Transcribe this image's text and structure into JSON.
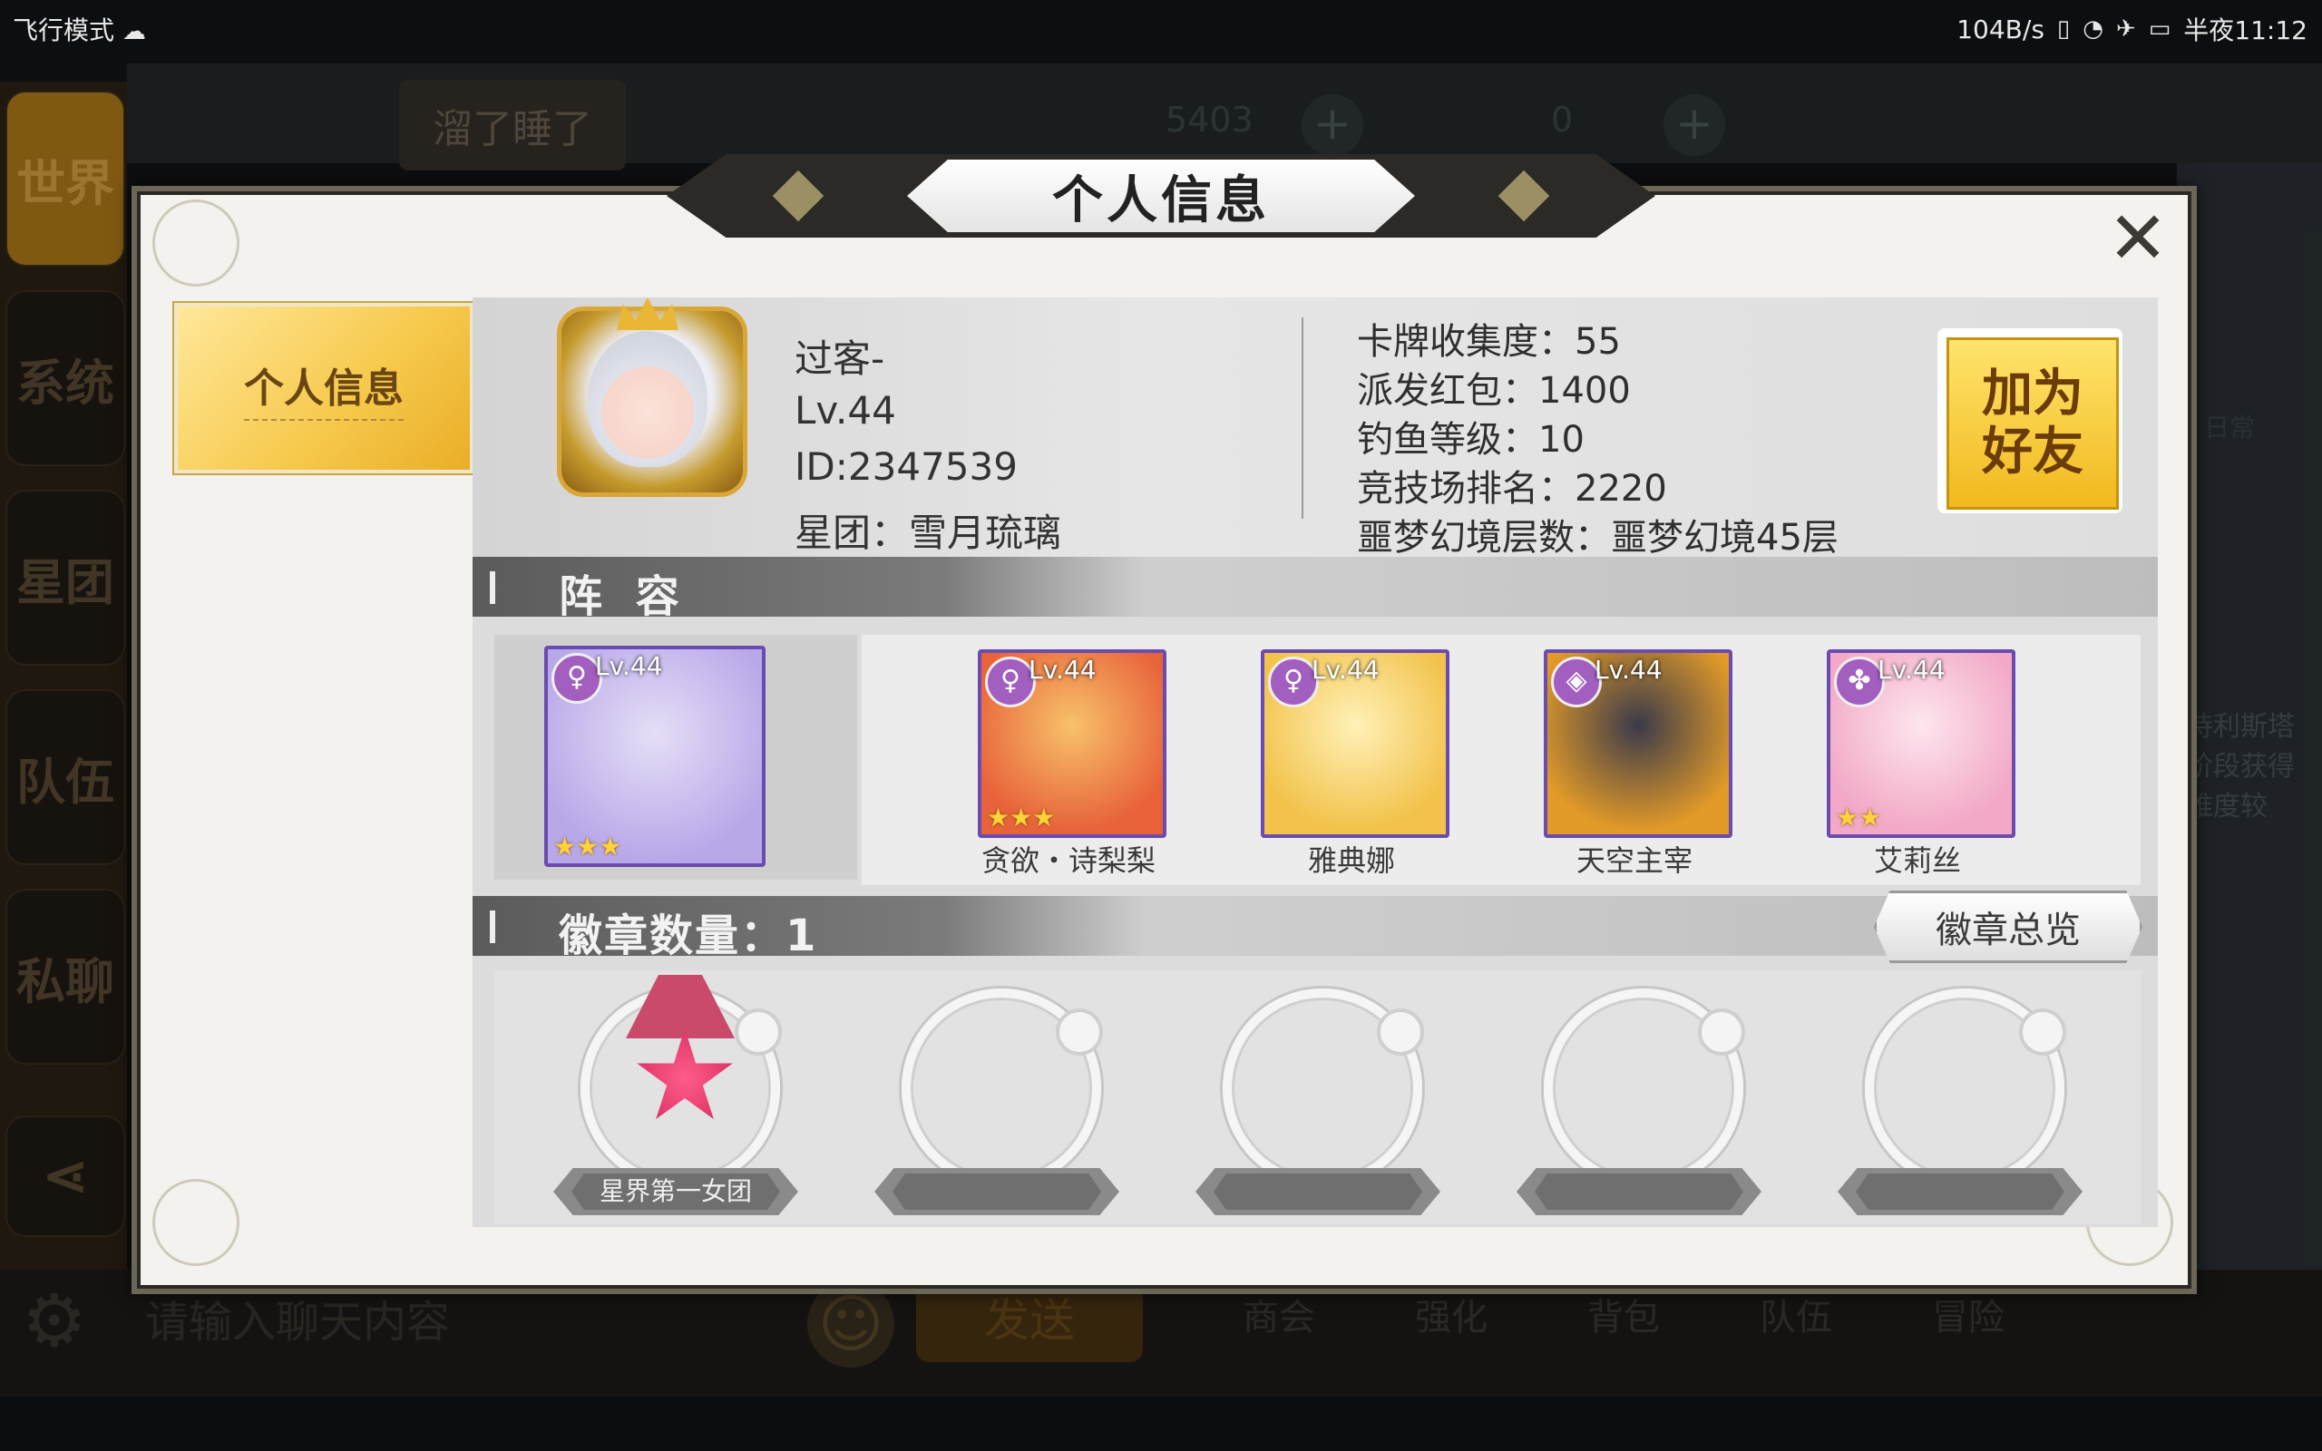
{
  "status_bar": {
    "left_text": "飞行模式",
    "speed": "104B/s",
    "time": "半夜11:12"
  },
  "background": {
    "side_tabs": [
      "世界",
      "系统",
      "星团",
      "队伍",
      "私聊"
    ],
    "chat_bubble": "溜了睡了",
    "top_value_1": "5403",
    "top_value_2": "0",
    "input_placeholder": "请输入聊天内容",
    "send_label": "发送",
    "bottom_tabs": [
      "商会",
      "强化",
      "背包",
      "队伍",
      "冒险"
    ],
    "right_text": [
      "诗利斯塔",
      "阶段获得",
      "难度较"
    ],
    "right_label": "日常"
  },
  "dialog": {
    "title": "个人信息",
    "close_symbol": "✕",
    "left_tab": "个人信息",
    "player": {
      "name": "过客-",
      "level": "Lv.44",
      "id": "ID:2347539",
      "guild": "星团：雪月琉璃"
    },
    "stats": [
      "卡牌收集度：55",
      "派发红包：1400",
      "钓鱼等级：10",
      "竞技场排名：2220",
      "噩梦幻境层数：噩梦幻境45层"
    ],
    "add_friend_label": "加为\n好友",
    "lineup_title": "阵 容",
    "cards": [
      {
        "level": "Lv.44",
        "name": "",
        "stars": "★★★",
        "element": "♀",
        "colors": [
          "#b8a8e8",
          "#e6def7"
        ]
      },
      {
        "level": "Lv.44",
        "name": "贪欲・诗梨梨",
        "stars": "★★★",
        "element": "♀",
        "colors": [
          "#e8623a",
          "#f7c26a"
        ]
      },
      {
        "level": "Lv.44",
        "name": "雅典娜",
        "stars": "",
        "element": "♀",
        "colors": [
          "#f2c24a",
          "#fff1b8"
        ]
      },
      {
        "level": "Lv.44",
        "name": "天空主宰",
        "stars": "",
        "element": "◈",
        "colors": [
          "#e29a28",
          "#3a3a4a"
        ]
      },
      {
        "level": "Lv.44",
        "name": "艾莉丝",
        "stars": "★★",
        "element": "✤",
        "colors": [
          "#f2a8c6",
          "#fde6ee"
        ]
      }
    ],
    "badge_title": "徽章数量：1",
    "badge_overview_label": "徽章总览",
    "badges": [
      {
        "name": "星界第一女团"
      },
      {
        "name": ""
      },
      {
        "name": ""
      },
      {
        "name": ""
      },
      {
        "name": ""
      }
    ]
  }
}
